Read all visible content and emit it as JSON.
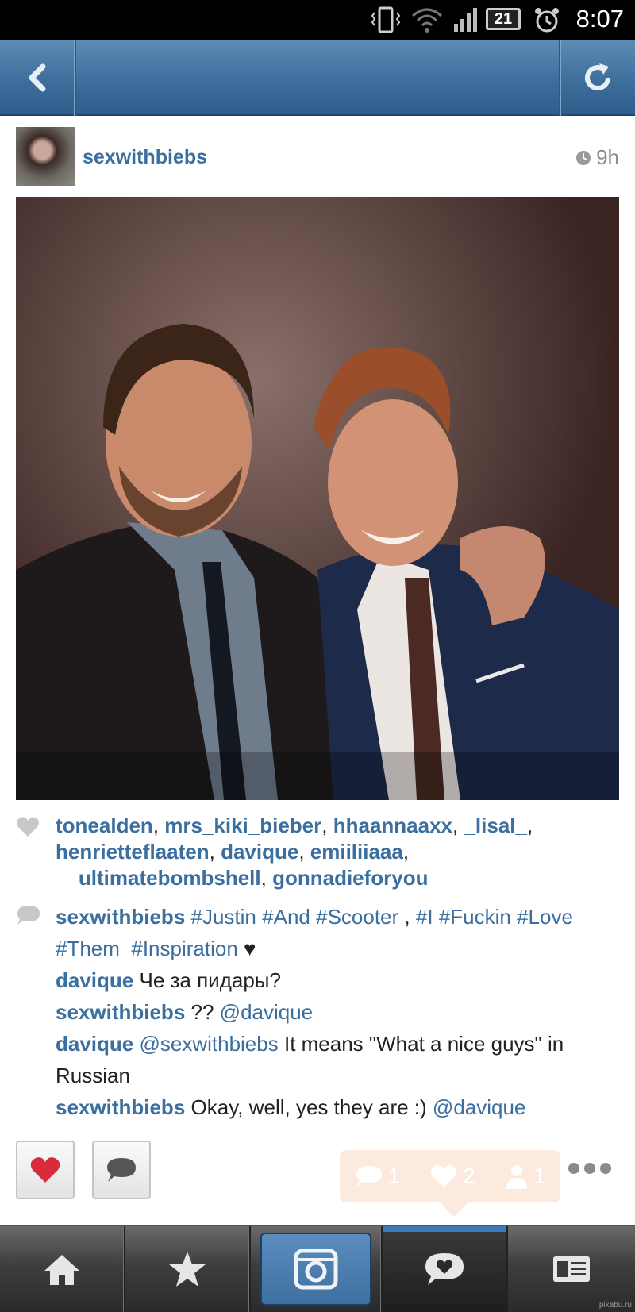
{
  "status_bar": {
    "time": "8:07",
    "battery": "21"
  },
  "post": {
    "username": "sexwithbiebs",
    "time_ago": "9h"
  },
  "likes": {
    "users": [
      "tonealden",
      "mrs_kiki_bieber",
      "hhaannaaxx",
      "_lisal_",
      "henrietteflaaten",
      "davique",
      "emiiliiaaa",
      "__ultimatebombshell",
      "gonnadieforyou"
    ]
  },
  "caption": {
    "user": "sexwithbiebs",
    "hashtags_line1": [
      "#Justin",
      "#And",
      "#Scooter"
    ],
    "comma": ",",
    "hashtags_line1b": [
      "#I",
      "#Fuckin",
      "#Love"
    ],
    "hashtags_line2": [
      "#Them",
      "#Inspiration"
    ],
    "heart": "♥"
  },
  "comments": [
    {
      "user": "davique",
      "text": "Че за пидары?"
    },
    {
      "user": "sexwithbiebs",
      "text": "??",
      "mention": "@davique"
    },
    {
      "user": "davique",
      "mention": "@sexwithbiebs",
      "text": "It means \"What a nice guys\" in Russian"
    },
    {
      "user": "sexwithbiebs",
      "text": "Okay, well, yes they are :)",
      "mention": "@davique"
    }
  ],
  "notification": {
    "comments": "1",
    "likes": "2",
    "followers": "1"
  },
  "watermark": "pikabu.ru",
  "colors": {
    "link": "#3a6f9f",
    "nav": "#3e6e9c",
    "like_red": "#d92b3a"
  },
  "icons": {
    "nav_left": "back-arrow-icon",
    "nav_right": "refresh-icon",
    "tabs": [
      "home-icon",
      "star-icon",
      "camera-icon",
      "news-heart-icon",
      "profile-card-icon"
    ]
  }
}
